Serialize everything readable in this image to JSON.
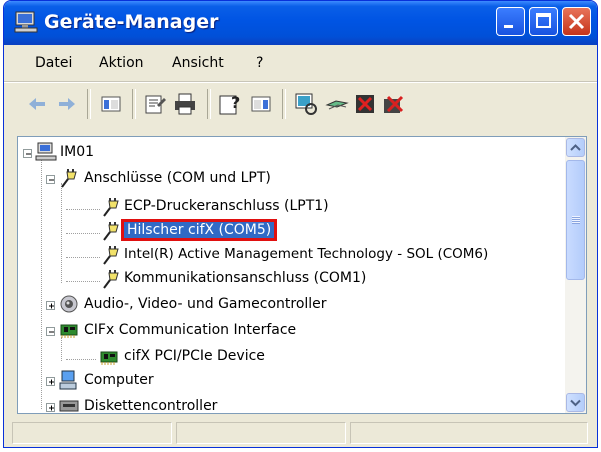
{
  "window": {
    "title": "Geräte-Manager",
    "title_icon": "computer-monitor-icon",
    "controls": [
      "minimize-icon",
      "maximize-icon",
      "close-icon"
    ]
  },
  "menu": {
    "items": [
      {
        "label": "Datei"
      },
      {
        "label": "Aktion"
      },
      {
        "label": "Ansicht"
      },
      {
        "label": "?"
      }
    ]
  },
  "toolbar": {
    "tools": [
      "back-arrow-icon",
      "forward-arrow-icon",
      "show-hide-console-tree-icon",
      "properties-icon",
      "print-icon",
      "help-icon",
      "action-pane-icon",
      "scan-hardware-icon",
      "update-driver-icon",
      "uninstall-icon",
      "disable-device-icon"
    ]
  },
  "tree": {
    "root": "IM01",
    "nodes": [
      {
        "label": "Anschlüsse (COM und LPT)",
        "icon": "port-connector-icon",
        "expanded": true,
        "children": [
          {
            "label": "ECP-Druckeranschluss (LPT1)",
            "icon": "port-connector-icon"
          },
          {
            "label": "Hilscher cifX (COM5)",
            "icon": "port-connector-icon",
            "selected": true
          },
          {
            "label": "Intel(R) Active Management Technology - SOL (COM6)",
            "icon": "port-connector-icon"
          },
          {
            "label": "Kommunikationsanschluss (COM1)",
            "icon": "port-connector-icon"
          }
        ]
      },
      {
        "label": "Audio-, Video- und Gamecontroller",
        "icon": "speaker-icon",
        "expanded": false
      },
      {
        "label": "CIFx Communication Interface",
        "icon": "circuit-board-icon",
        "expanded": true,
        "children": [
          {
            "label": "cifX PCI/PCIe Device",
            "icon": "circuit-board-icon"
          }
        ]
      },
      {
        "label": "Computer",
        "icon": "computer-icon",
        "expanded": false
      },
      {
        "label": "Diskettencontroller",
        "icon": "floppy-controller-icon",
        "expanded": false
      }
    ]
  },
  "colors": {
    "title_bar": "#0054e3",
    "selection": "#316ac5",
    "highlight_border": "#e01010",
    "window_bg": "#ece9d8"
  }
}
